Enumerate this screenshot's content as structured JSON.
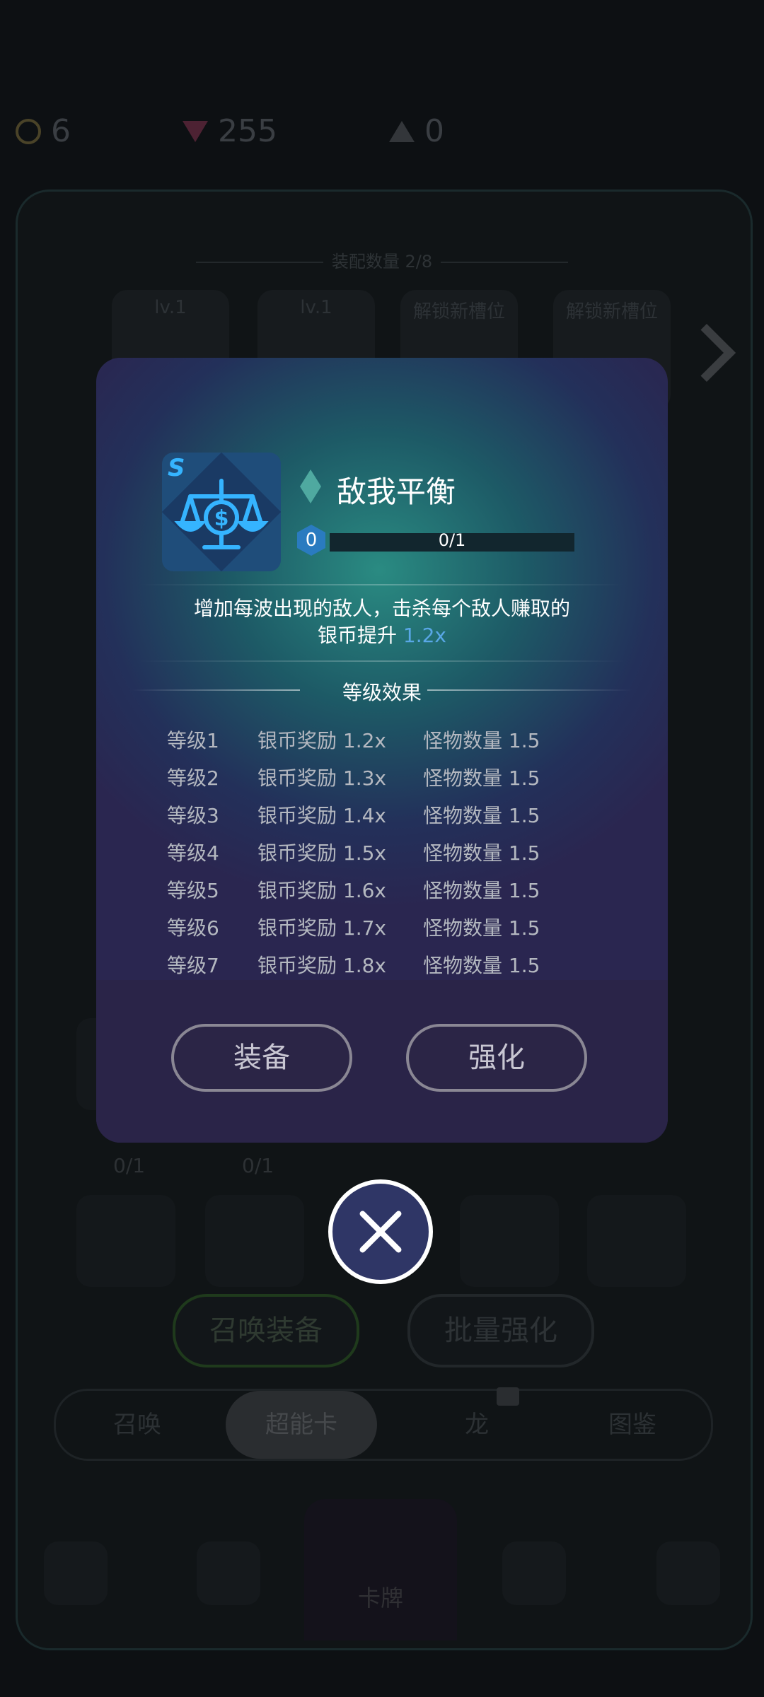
{
  "background": {
    "currencies": [
      {
        "icon": "coin-icon",
        "value": "6"
      },
      {
        "icon": "gem-icon",
        "value": "255"
      },
      {
        "icon": "triangle-token-icon",
        "value": "0"
      }
    ],
    "equip_count_label": "装配数量 2/8",
    "slots": [
      "lv.1",
      "lv.1",
      "解锁新槽位",
      "解锁新槽位"
    ],
    "card_counts": [
      "0/1",
      "0/1"
    ],
    "buttons": {
      "summon": "召唤装备",
      "batch_upgrade": "批量强化"
    },
    "tabs": [
      "召唤",
      "超能卡",
      "龙",
      "图鉴"
    ],
    "active_tab": "超能卡",
    "nav_center_label": "卡牌"
  },
  "modal": {
    "rank_badge": "S",
    "title": "敌我平衡",
    "level": "0",
    "progress_text": "0/1",
    "progress_fraction": 0,
    "description_main": "增加每波出现的敌人，击杀每个敌人赚取的",
    "description_prefix": "银币提升",
    "description_highlight": "1.2x",
    "section_title": "等级效果",
    "levels": [
      {
        "level": "等级1",
        "reward": "银币奖励 1.2x",
        "monsters": "怪物数量 1.5"
      },
      {
        "level": "等级2",
        "reward": "银币奖励 1.3x",
        "monsters": "怪物数量 1.5"
      },
      {
        "level": "等级3",
        "reward": "银币奖励 1.4x",
        "monsters": "怪物数量 1.5"
      },
      {
        "level": "等级4",
        "reward": "银币奖励 1.5x",
        "monsters": "怪物数量 1.5"
      },
      {
        "level": "等级5",
        "reward": "银币奖励 1.6x",
        "monsters": "怪物数量 1.5"
      },
      {
        "level": "等级6",
        "reward": "银币奖励 1.7x",
        "monsters": "怪物数量 1.5"
      },
      {
        "level": "等级7",
        "reward": "银币奖励 1.8x",
        "monsters": "怪物数量 1.5"
      }
    ],
    "equip_button": "装备",
    "upgrade_button": "强化"
  },
  "colors": {
    "accent_blue": "#59a7e6",
    "modal_teal": "#2a8b82",
    "close_button": "#2f3666"
  }
}
